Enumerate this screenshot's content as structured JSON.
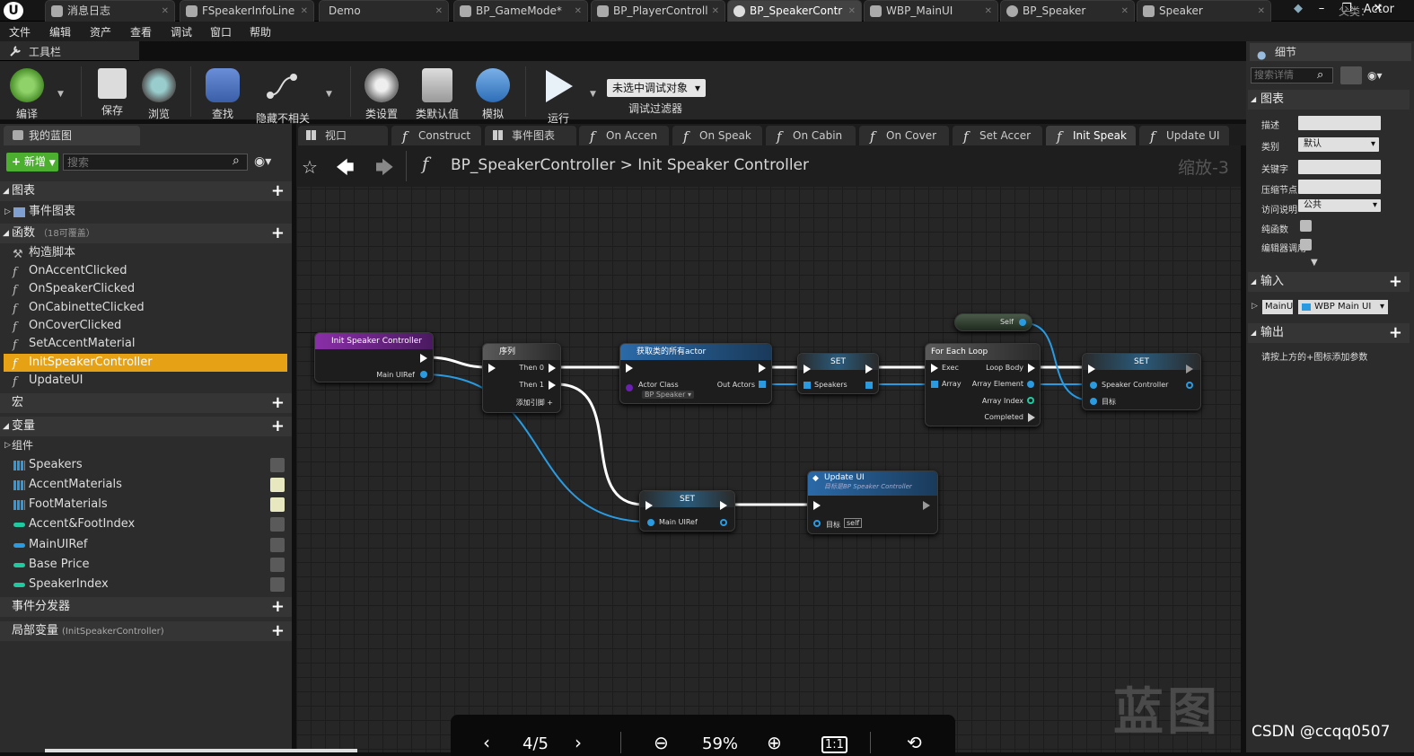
{
  "top_tabs": [
    {
      "label": "消息日志"
    },
    {
      "label": "FSpeakerInfoLine"
    },
    {
      "label": "Demo"
    },
    {
      "label": "BP_GameMode*"
    },
    {
      "label": "BP_PlayerControll"
    },
    {
      "label": "BP_SpeakerContr"
    },
    {
      "label": "WBP_MainUI"
    },
    {
      "label": "BP_Speaker"
    },
    {
      "label": "Speaker"
    }
  ],
  "menu": [
    "文件",
    "编辑",
    "资产",
    "查看",
    "调试",
    "窗口",
    "帮助"
  ],
  "parent_class": {
    "label": "父类：",
    "value": "Actor"
  },
  "toolbar": {
    "header": "工具栏",
    "compile": "编译",
    "save": "保存",
    "browse": "浏览",
    "find": "查找",
    "hide_unrelated": "隐藏不相关",
    "class_settings": "类设置",
    "class_defaults": "类默认值",
    "simulate": "模拟",
    "play": "运行",
    "debug_object": "未选中调试对象",
    "debug_filter": "调试过滤器"
  },
  "my_blueprint": {
    "tab": "我的蓝图",
    "new_button": "新增",
    "search_placeholder": "搜索",
    "graphs_header": "图表",
    "event_graph": "事件图表",
    "functions_header": "函数",
    "functions_override": "（18可覆盖）",
    "functions": [
      "构造脚本",
      "OnAccentClicked",
      "OnSpeakerClicked",
      "OnCabinetteClicked",
      "OnCoverClicked",
      "SetAccentMaterial",
      "InitSpeakerController",
      "UpdateUI"
    ],
    "macros_header": "宏",
    "variables_header": "变量",
    "components_header": "组件",
    "variables": [
      "Speakers",
      "AccentMaterials",
      "FootMaterials",
      "Accent&FootIndex",
      "MainUIRef",
      "Base Price",
      "SpeakerIndex"
    ],
    "dispatchers_header": "事件分发器",
    "locals_header": "局部变量",
    "locals_scope": "(InitSpeakerController)"
  },
  "graph_tabs": [
    "视口",
    "Construct",
    "事件图表",
    "On Accen",
    "On Speak",
    "On Cabin",
    "On Cover",
    "Set Accer",
    "Init Speak",
    "Update UI"
  ],
  "breadcrumb": {
    "blueprint": "BP_SpeakerController",
    "separator": ">",
    "function": "Init Speaker Controller",
    "zoom": "缩放-3"
  },
  "nodes": {
    "entry": {
      "title": "Init Speaker Controller",
      "pin": "Main UIRef"
    },
    "sequence": {
      "title": "序列",
      "then0": "Then 0",
      "then1": "Then 1",
      "add_pin": "添加引脚"
    },
    "get_all": {
      "title": "获取类的所有actor",
      "class_pin": "Actor Class",
      "class_val": "BP Speaker",
      "out": "Out Actors"
    },
    "set_speakers": {
      "title": "SET",
      "pin": "Speakers"
    },
    "foreach": {
      "title": "For Each Loop",
      "exec": "Exec",
      "array": "Array",
      "loop_body": "Loop Body",
      "element": "Array Element",
      "index": "Array Index",
      "completed": "Completed"
    },
    "self_node": {
      "title": "Self"
    },
    "set_controller": {
      "title": "SET",
      "pin": "Speaker Controller",
      "target": "目标"
    },
    "set_mainui": {
      "title": "SET",
      "pin": "Main UIRef"
    },
    "update_ui": {
      "title": "Update UI",
      "subtitle": "目标是BP Speaker Controller",
      "target": "目标",
      "self": "self"
    }
  },
  "watermark": "蓝图",
  "details": {
    "header": "细节",
    "search_placeholder": "搜索详情",
    "graph_header": "图表",
    "fields": [
      {
        "label": "描述",
        "value": ""
      },
      {
        "label": "类别",
        "value": "默认"
      },
      {
        "label": "关键字",
        "value": ""
      },
      {
        "label": "压缩节点",
        "value": ""
      },
      {
        "label": "访问说明",
        "value": "公共"
      }
    ],
    "pure": "纯函数",
    "editor": "编辑器调用",
    "inputs_header": "输入",
    "input_name": "MainU",
    "input_type": "WBP Main UI",
    "outputs_header": "输出",
    "outputs_hint": "请按上方的+图标添加参数"
  },
  "viewer": {
    "page": "4/5",
    "zoom": "59%",
    "actual": "1:1"
  },
  "credit": "CSDN @ccqq0507",
  "colors": {
    "exec": "#ffffff",
    "object_pin": "#2a9be0",
    "selected": "#e6a214",
    "new_button": "#4caf30"
  }
}
